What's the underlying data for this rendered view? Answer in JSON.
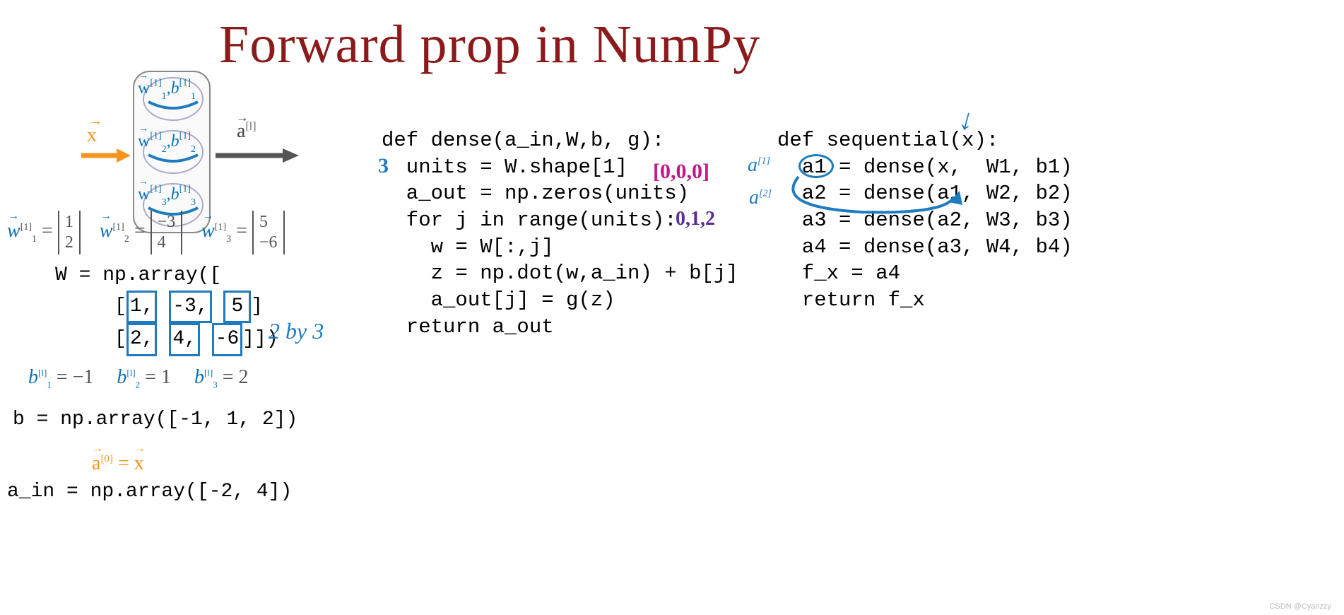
{
  "title": "Forward prop in NumPy",
  "diagram": {
    "x_label": "x",
    "a_label": "a",
    "a_super": "[l]",
    "neurons": [
      {
        "w": "w",
        "wsub": "1",
        "wsup": "[1]",
        "b": "b",
        "bsub": "1",
        "bsup": "[1]"
      },
      {
        "w": "w",
        "wsub": "2",
        "wsup": "[1]",
        "b": "b",
        "bsub": "2",
        "bsup": "[1]"
      },
      {
        "w": "w",
        "wsub": "3",
        "wsup": "[1]",
        "b": "b",
        "bsub": "3",
        "bsup": "[1]"
      }
    ]
  },
  "w_vectors": [
    {
      "label": "w",
      "sub": "1",
      "sup": "[1]",
      "vals": [
        "1",
        "2"
      ]
    },
    {
      "label": "w",
      "sub": "2",
      "sup": "[1]",
      "vals": [
        "−3",
        "4"
      ]
    },
    {
      "label": "w",
      "sub": "3",
      "sup": "[1]",
      "vals": [
        "5",
        "−6"
      ]
    }
  ],
  "W_code": {
    "l1": "W = np.array([",
    "l2a": "[",
    "l2b": "1,",
    "l2c": "-3,",
    "l2d": "5",
    "l2e": "]",
    "l3a": "[",
    "l3b": "2,",
    "l3c": "4,",
    "l3d": "-6",
    "l3e": "]])"
  },
  "annot_2by3": "2 by 3",
  "b_scalars": [
    {
      "b": "b",
      "sub": "1",
      "sup": "[l]",
      "val": "= −1"
    },
    {
      "b": "b",
      "sub": "2",
      "sup": "[l]",
      "val": "= 1"
    },
    {
      "b": "b",
      "sub": "3",
      "sup": "[l]",
      "val": "= 2"
    }
  ],
  "b_code": "b = np.array([-1, 1, 2])",
  "a0_eq_lhs": "a",
  "a0_sup": "[0]",
  "a0_eq_mid": " = ",
  "a0_eq_rhs": "x",
  "ain_code": "a_in = np.array([-2, 4])",
  "dense_code": "def dense(a_in,W,b, g):\n  units = W.shape[1]\n  a_out = np.zeros(units)\n  for j in range(units):\n    w = W[:,j]\n    z = np.dot(w,a_in) + b[j]\n    a_out[j] = g(z)\n  return a_out",
  "seq_code": "def sequential(x):\n  a1 = dense(x,  W1, b1)\n  a2 = dense(a1, W2, b2)\n  a3 = dense(a2, W3, b3)\n  a4 = dense(a3, W4, b4)\n  f_x = a4\n  return f_x",
  "annotations": {
    "three": "3",
    "zeros": "[0,0,0]",
    "range_vals": "0,1,2",
    "a_l1": "a",
    "a_l1_sup": "[1]",
    "a_l2": "a",
    "a_l2_sup": "[2]"
  },
  "watermark": "CSDN @Cyanzzy"
}
